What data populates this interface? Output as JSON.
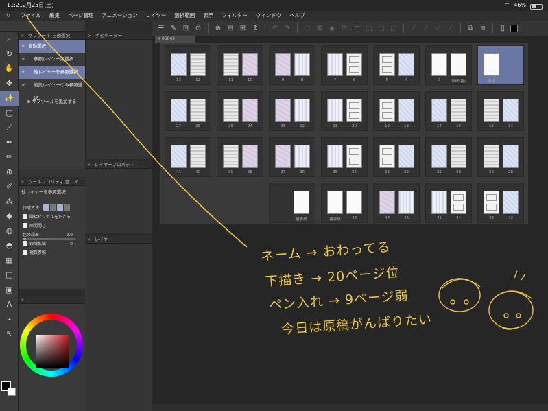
{
  "status": {
    "time": "11:21",
    "date": "2月25日(土)",
    "battery": "46%",
    "battery_level": 0.46
  },
  "menu": [
    "ファイル",
    "編集",
    "ページ管理",
    "アニメーション",
    "レイヤー",
    "選択範囲",
    "表示",
    "フィルター",
    "ウィンドウ",
    "ヘルプ"
  ],
  "subtool_panel": {
    "title": "サブツール[自動選択]",
    "items": [
      {
        "label": "自動選択",
        "selected": true,
        "level": 1
      },
      {
        "label": "参照レイヤー用選択",
        "selected": false,
        "level": 2
      },
      {
        "label": "他レイヤーを参照選択",
        "selected": true,
        "level": 2
      },
      {
        "label": "編集レイヤーのみ参照選択",
        "selected": false,
        "level": 2
      }
    ],
    "add_label": "サブツールを追加する"
  },
  "tool_property": {
    "title": "ツールプロパティ[他レイ",
    "name": "他レイヤーを参照選択",
    "mode_label": "作成方法",
    "anti_label": "隣接ピクセルをたどる",
    "gap_label": "隙間閉じ",
    "tolerance_label": "色の誤差",
    "tolerance_value": "2.0",
    "tolerance_fraction": 0.02,
    "expand_label": "領域拡縮",
    "expand_value": "0",
    "multi_ref_label": "複数参照"
  },
  "navigator": {
    "title": "ナビゲーター"
  },
  "layer_property": {
    "title": "レイヤープロパティ"
  },
  "layer_panel": {
    "title": "レイヤー"
  },
  "document": {
    "tab": "0504II"
  },
  "pages": {
    "row1": [
      [
        "13",
        "12"
      ],
      [
        "11",
        "10"
      ],
      [
        "9",
        "8"
      ],
      [
        "7",
        "6"
      ],
      [
        "5",
        "4"
      ],
      [
        "3",
        "表紙(裏)"
      ],
      [
        "表紙"
      ]
    ],
    "row2": [
      [
        "27",
        "26"
      ],
      [
        "25",
        "24"
      ],
      [
        "23",
        "22"
      ],
      [
        "21",
        "20"
      ],
      [
        "19",
        "18"
      ],
      [
        "17",
        "16"
      ],
      [
        "15",
        "14"
      ]
    ],
    "row3": [
      [
        "41",
        "40"
      ],
      [
        "39",
        "38"
      ],
      [
        "37",
        "36"
      ],
      [
        "35",
        "34"
      ],
      [
        "33",
        "32"
      ],
      [
        "31",
        "30"
      ],
      [
        "29",
        "28"
      ]
    ],
    "row4": [
      [
        "裏表紙"
      ],
      [
        "裏表紙",
        "48"
      ],
      [
        "47",
        "46"
      ],
      [
        "45",
        "44"
      ],
      [
        "43",
        "42"
      ]
    ]
  },
  "handwriting": [
    "ネーム → おわってる",
    "下描き → 20ページ位",
    "ペン入れ → 9ページ弱",
    "今日は原稿がんばりたい"
  ],
  "colors": {
    "accent": "#6f7ba6",
    "ink": "#e7c44a"
  },
  "icons": [
    "menu-icon",
    "new-icon",
    "open-icon",
    "save-icon",
    "undo-icon",
    "redo-icon",
    "zoom-icon",
    "hand-icon",
    "pen-icon",
    "brush-icon",
    "eraser-icon",
    "fill-icon",
    "text-icon",
    "eyedropper-icon",
    "lasso-icon"
  ]
}
